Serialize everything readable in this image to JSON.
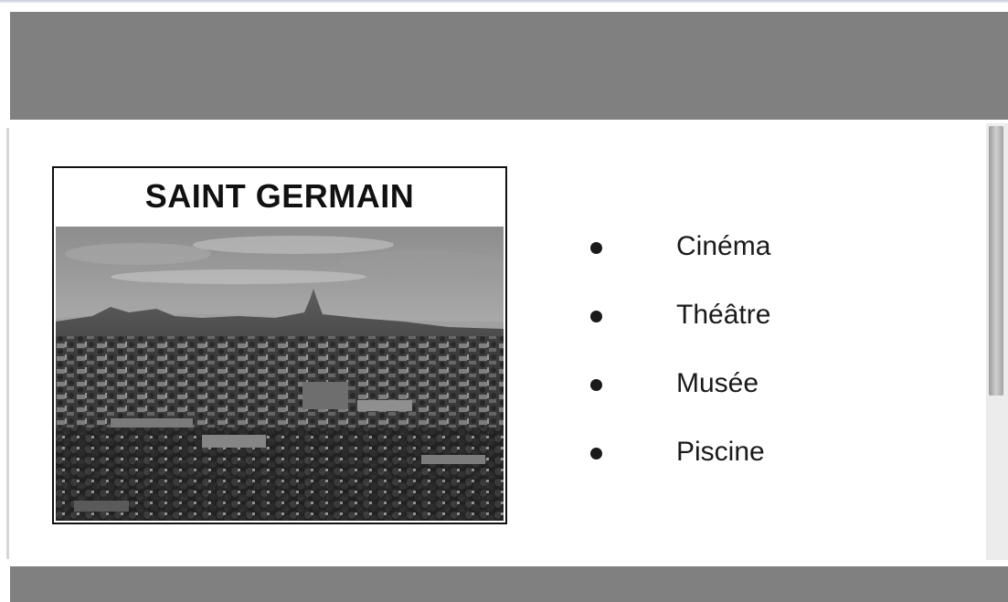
{
  "card": {
    "title": "SAINT GERMAIN"
  },
  "facilities": [
    {
      "label": "Cinéma"
    },
    {
      "label": "Théâtre"
    },
    {
      "label": "Musée"
    },
    {
      "label": "Piscine"
    }
  ],
  "icons": {
    "bullet": "bullet-dot-icon",
    "photo": "cityscape-photo"
  },
  "colors": {
    "band": "#808080",
    "text": "#1a1a1a",
    "background": "#ffffff"
  }
}
